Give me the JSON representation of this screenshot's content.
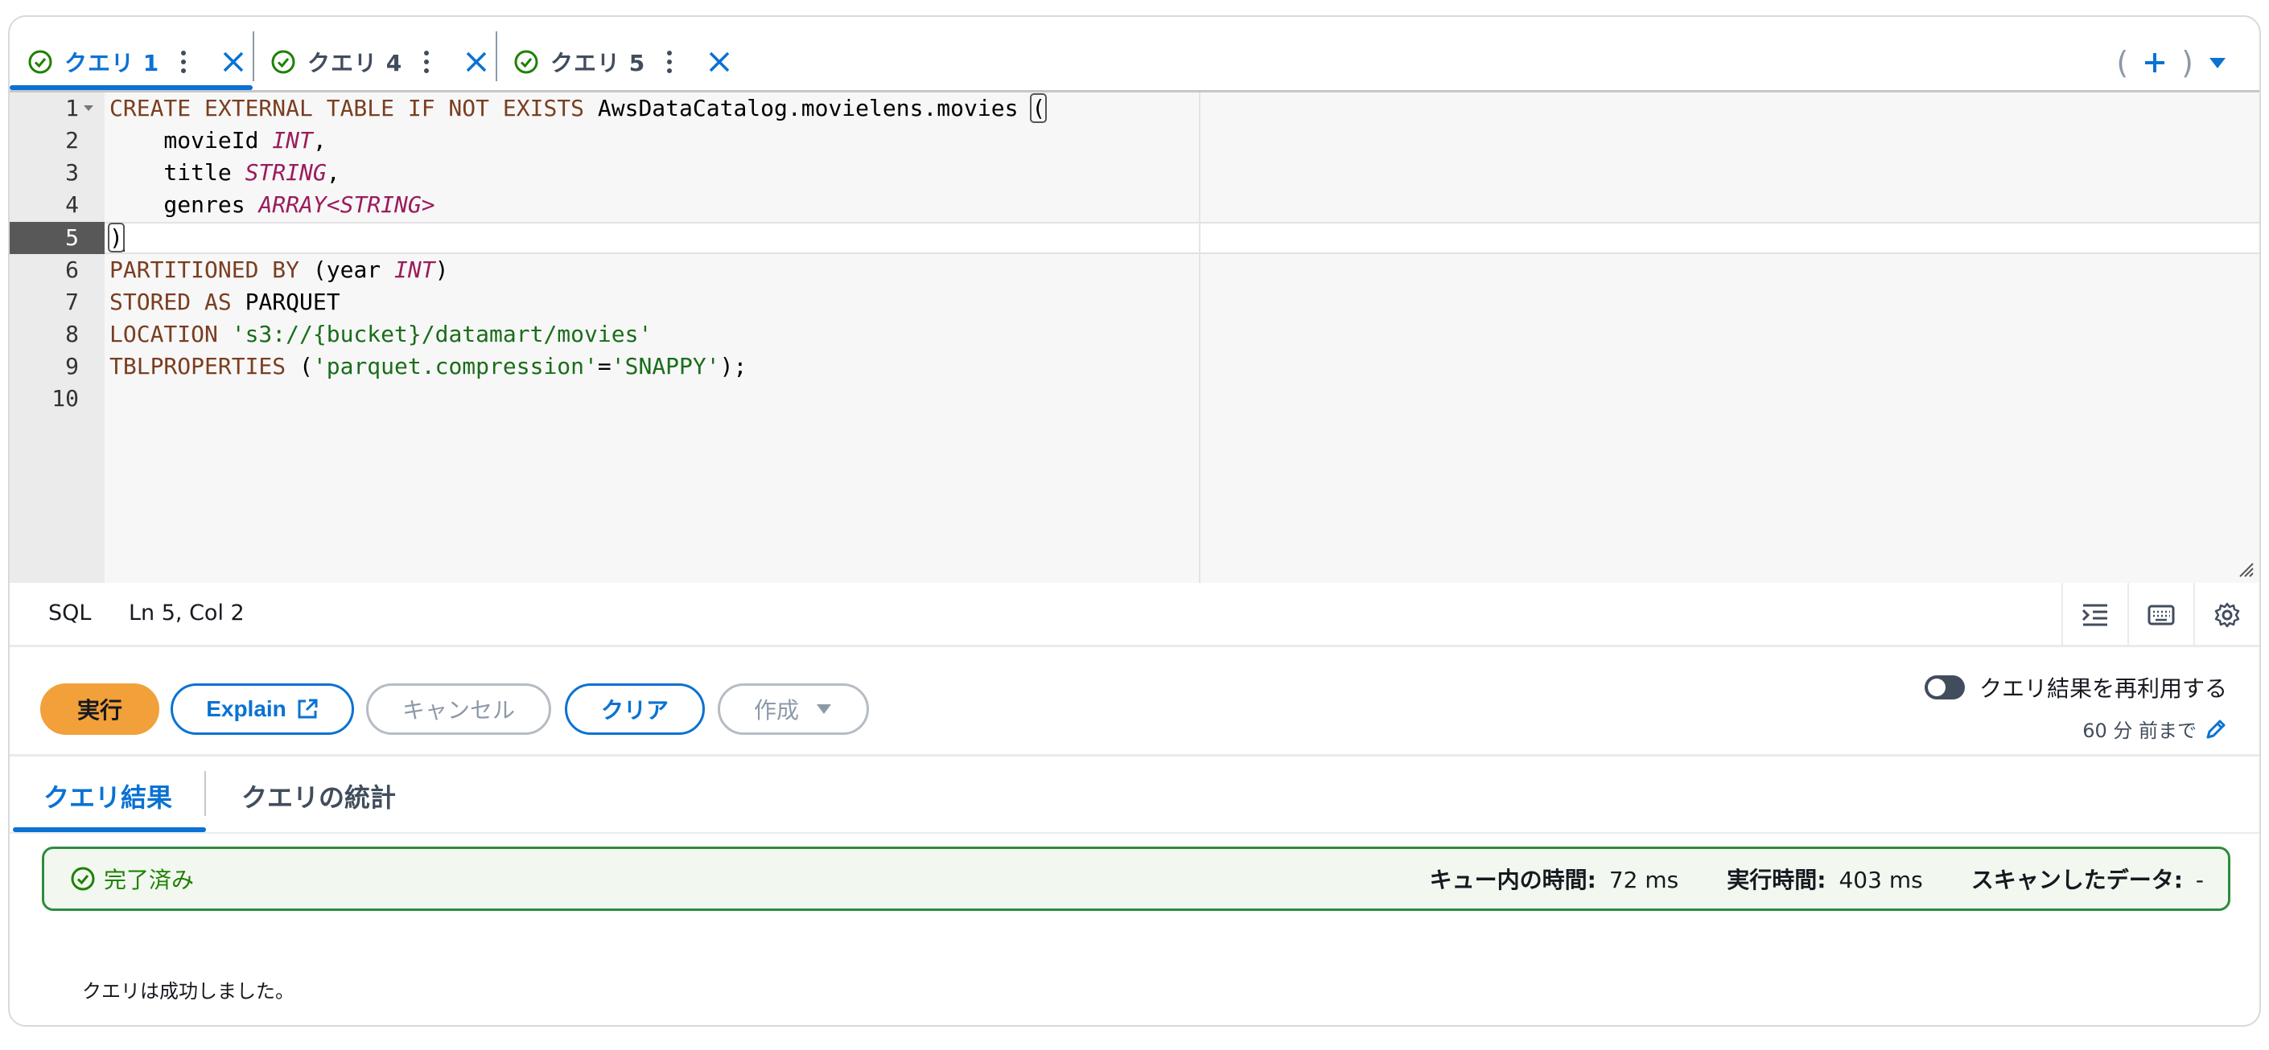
{
  "tabs": [
    {
      "label": "クエリ 1",
      "active": true
    },
    {
      "label": "クエリ 4",
      "active": false
    },
    {
      "label": "クエリ 5",
      "active": false
    }
  ],
  "tab_actions": {
    "open_paren": "(",
    "add": "+",
    "close_paren": ")"
  },
  "editor": {
    "line_numbers": [
      "1",
      "2",
      "3",
      "4",
      "5",
      "6",
      "7",
      "8",
      "9",
      "10"
    ],
    "active_line": "5",
    "code": {
      "l1_kw": "CREATE EXTERNAL TABLE IF NOT EXISTS",
      "l1_name": " AwsDataCatalog.movielens.movies ",
      "l1_bracket": "(",
      "l2_name": "    movieId ",
      "l2_type": "INT",
      "l2_end": ",",
      "l3_name": "    title ",
      "l3_type": "STRING",
      "l3_end": ",",
      "l4_name": "    genres ",
      "l4_type": "ARRAY<STRING>",
      "l5_bracket": ")",
      "l6_kw": "PARTITIONED BY",
      "l6_open": " (year ",
      "l6_type": "INT",
      "l6_close": ")",
      "l7_kw": "STORED AS",
      "l7_val": " PARQUET",
      "l8_kw": "LOCATION",
      "l8_sp": " ",
      "l8_str": "'s3://{bucket}/datamart/movies'",
      "l9_kw": "TBLPROPERTIES",
      "l9_open": " (",
      "l9_str1": "'parquet.compression'",
      "l9_eq": "=",
      "l9_str2": "'SNAPPY'",
      "l9_end": ");"
    }
  },
  "status": {
    "language": "SQL",
    "position": "Ln 5, Col 2"
  },
  "actions": {
    "run": "実行",
    "explain": "Explain",
    "cancel": "キャンセル",
    "clear": "クリア",
    "create": "作成",
    "reuse_label": "クエリ結果を再利用する",
    "reuse_sub": "60 分 前まで",
    "reuse_enabled": false
  },
  "result_tabs": [
    {
      "label": "クエリ結果",
      "active": true
    },
    {
      "label": "クエリの統計",
      "active": false
    }
  ],
  "alert": {
    "status": "完了済み",
    "queue_label": "キュー内の時間:",
    "queue_value": "72 ms",
    "exec_label": "実行時間:",
    "exec_value": "403 ms",
    "scan_label": "スキャンしたデータ:",
    "scan_value": "-"
  },
  "message": "クエリは成功しました。",
  "colors": {
    "accent": "#0972d3",
    "run": "#f2a03a",
    "success": "#1d8102"
  }
}
